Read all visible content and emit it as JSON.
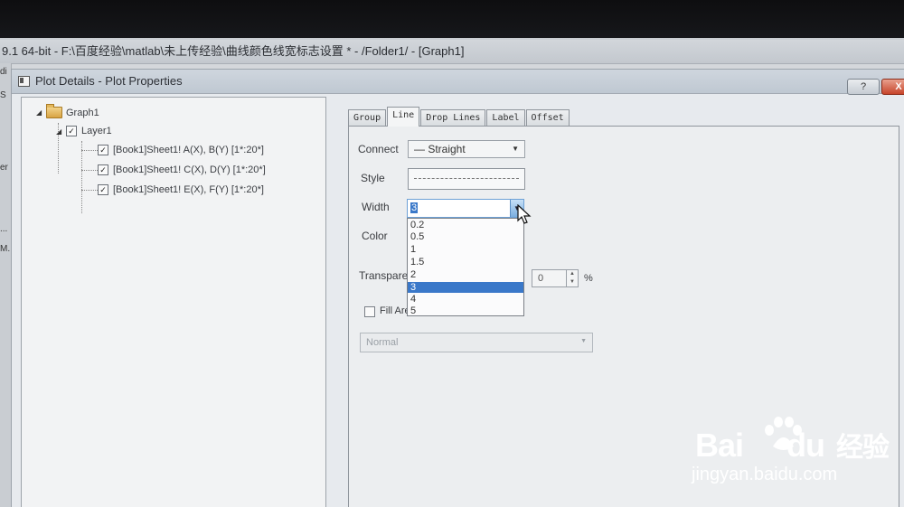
{
  "app_title": "9.1 64-bit - F:\\百度经验\\matlab\\未上传经验\\曲线颜色线宽标志设置 * - /Folder1/ - [Graph1]",
  "left_strip": [
    "di",
    "S",
    "er",
    "...",
    "M."
  ],
  "dialog": {
    "title": "Plot Details - Plot Properties",
    "help_label": "?",
    "close_label": "X"
  },
  "tree": {
    "root": "Graph1",
    "layer": "Layer1",
    "datasets": [
      "[Book1]Sheet1! A(X), B(Y) [1*:20*]",
      "[Book1]Sheet1! C(X), D(Y) [1*:20*]",
      "[Book1]Sheet1! E(X), F(Y) [1*:20*]"
    ]
  },
  "tabs": [
    {
      "label": "Group",
      "active": false
    },
    {
      "label": "Line",
      "active": true
    },
    {
      "label": "Drop Lines",
      "active": false
    },
    {
      "label": "Label",
      "active": false
    },
    {
      "label": "Offset",
      "active": false
    }
  ],
  "line_tab": {
    "connect_label": "Connect",
    "connect_value": "—  Straight",
    "style_label": "Style",
    "width_label": "Width",
    "width_value": "3",
    "width_options": [
      "0.2",
      "0.5",
      "1",
      "1.5",
      "2",
      "3",
      "4",
      "5"
    ],
    "width_selected_index": 5,
    "color_label": "Color",
    "transparency_label": "Transparer",
    "transparency_value": "0",
    "transparency_unit": "%",
    "fill_area_label": "Fill Are",
    "fill_mode_value": "Normal"
  },
  "watermark": {
    "logo_text": "Bai",
    "logo_text2": "du",
    "logo_cn": "经验",
    "url": "jingyan.baidu.com"
  },
  "colors": {
    "selection": "#3a78c9",
    "close_button": "#c7442a"
  }
}
